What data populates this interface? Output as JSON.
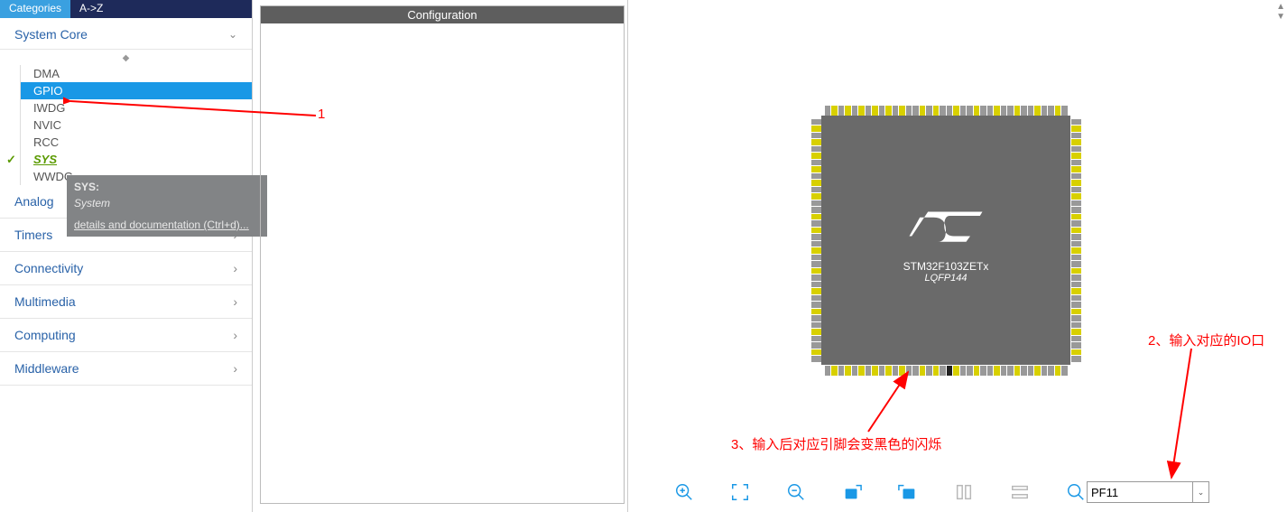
{
  "tabs": {
    "categories": "Categories",
    "az": "A->Z"
  },
  "sidebar": {
    "system_core": "System Core",
    "items": [
      "DMA",
      "GPIO",
      "IWDG",
      "NVIC",
      "RCC",
      "SYS",
      "WWDG"
    ],
    "selectedIndex": 1,
    "sysIndex": 5,
    "groups": [
      "Analog",
      "Timers",
      "Connectivity",
      "Multimedia",
      "Computing",
      "Middleware"
    ]
  },
  "tooltip": {
    "title": "SYS:",
    "subtitle": "System",
    "link": "details and documentation (Ctrl+d)..."
  },
  "config": {
    "title": "Configuration"
  },
  "chip": {
    "name": "STM32F103ZETx",
    "package": "LQFP144"
  },
  "search": {
    "value": "PF11"
  },
  "annotations": {
    "a1": "1",
    "a2": "2、输入对应的IO口",
    "a3": "3、输入后对应引脚会变黑色的闪烁"
  },
  "toolbar": {
    "icons": [
      "zoom-in-icon",
      "fit-icon",
      "zoom-out-icon",
      "rotate-right-icon",
      "rotate-left-icon",
      "layers-icon",
      "grid-icon",
      "search-icon"
    ]
  }
}
